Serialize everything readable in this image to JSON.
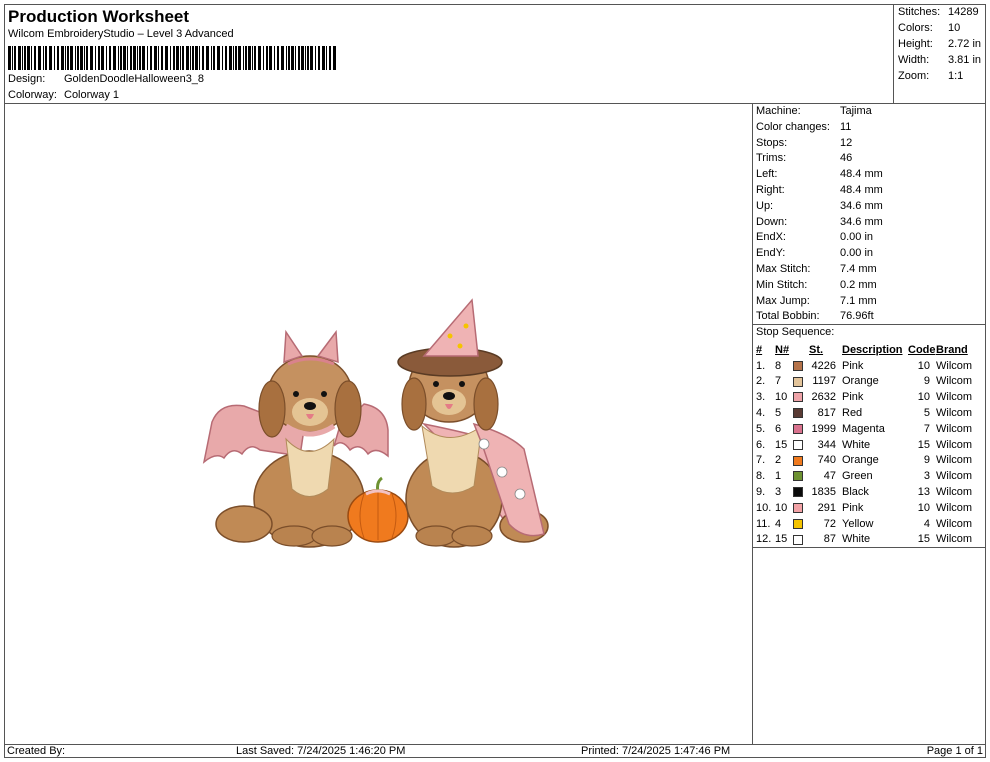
{
  "header": {
    "title": "Production Worksheet",
    "subtitle": "Wilcom EmbroideryStudio – Level 3 Advanced",
    "design_label": "Design:",
    "design_value": "GoldenDoodleHalloween3_8",
    "colorway_label": "Colorway:",
    "colorway_value": "Colorway 1"
  },
  "summary": [
    {
      "label": "Stitches:",
      "value": "14289"
    },
    {
      "label": "Colors:",
      "value": "10"
    },
    {
      "label": "Height:",
      "value": "2.72 in"
    },
    {
      "label": "Width:",
      "value": "3.81 in"
    },
    {
      "label": "Zoom:",
      "value": "1:1"
    }
  ],
  "machine_info": [
    {
      "label": "Machine:",
      "value": "Tajima"
    },
    {
      "label": "Color changes:",
      "value": "11"
    },
    {
      "label": "Stops:",
      "value": "12"
    },
    {
      "label": "Trims:",
      "value": "46"
    },
    {
      "label": "Left:",
      "value": "48.4 mm"
    },
    {
      "label": "Right:",
      "value": "48.4 mm"
    },
    {
      "label": "Up:",
      "value": "34.6 mm"
    },
    {
      "label": "Down:",
      "value": "34.6 mm"
    },
    {
      "label": "EndX:",
      "value": "0.00 in"
    },
    {
      "label": "EndY:",
      "value": "0.00 in"
    },
    {
      "label": "Max Stitch:",
      "value": "7.4 mm"
    },
    {
      "label": "Min Stitch:",
      "value": "0.2 mm"
    },
    {
      "label": "Max Jump:",
      "value": "7.1 mm"
    },
    {
      "label": "Total Bobbin:",
      "value": "76.96ft"
    }
  ],
  "stop_sequence": {
    "title": "Stop Sequence:",
    "headers": {
      "num": "#",
      "n": "N#",
      "st": "St.",
      "desc": "Description",
      "code": "Code",
      "brand": "Brand"
    },
    "rows": [
      {
        "num": "1.",
        "n": "8",
        "color": "#b5734a",
        "st": "4226",
        "desc": "Pink",
        "code": "10",
        "brand": "Wilcom"
      },
      {
        "num": "2.",
        "n": "7",
        "color": "#e3c49a",
        "st": "1197",
        "desc": "Orange",
        "code": "9",
        "brand": "Wilcom"
      },
      {
        "num": "3.",
        "n": "10",
        "color": "#eea3a8",
        "st": "2632",
        "desc": "Pink",
        "code": "10",
        "brand": "Wilcom"
      },
      {
        "num": "4.",
        "n": "5",
        "color": "#5a3b34",
        "st": "817",
        "desc": "Red",
        "code": "5",
        "brand": "Wilcom"
      },
      {
        "num": "5.",
        "n": "6",
        "color": "#d9728e",
        "st": "1999",
        "desc": "Magenta",
        "code": "7",
        "brand": "Wilcom"
      },
      {
        "num": "6.",
        "n": "15",
        "color": "#ffffff",
        "st": "344",
        "desc": "White",
        "code": "15",
        "brand": "Wilcom"
      },
      {
        "num": "7.",
        "n": "2",
        "color": "#f07a1e",
        "st": "740",
        "desc": "Orange",
        "code": "9",
        "brand": "Wilcom"
      },
      {
        "num": "8.",
        "n": "1",
        "color": "#6e9232",
        "st": "47",
        "desc": "Green",
        "code": "3",
        "brand": "Wilcom"
      },
      {
        "num": "9.",
        "n": "3",
        "color": "#0a0a0a",
        "st": "1835",
        "desc": "Black",
        "code": "13",
        "brand": "Wilcom"
      },
      {
        "num": "10.",
        "n": "10",
        "color": "#f2a2a6",
        "st": "291",
        "desc": "Pink",
        "code": "10",
        "brand": "Wilcom"
      },
      {
        "num": "11.",
        "n": "4",
        "color": "#f5c400",
        "st": "72",
        "desc": "Yellow",
        "code": "4",
        "brand": "Wilcom"
      },
      {
        "num": "12.",
        "n": "15",
        "color": "#ffffff",
        "st": "87",
        "desc": "White",
        "code": "15",
        "brand": "Wilcom"
      }
    ]
  },
  "footer": {
    "created_by": "Created By:",
    "last_saved": "Last Saved: 7/24/2025 1:46:20 PM",
    "printed": "Printed: 7/24/2025 1:47:46 PM",
    "page": "Page 1 of 1"
  }
}
